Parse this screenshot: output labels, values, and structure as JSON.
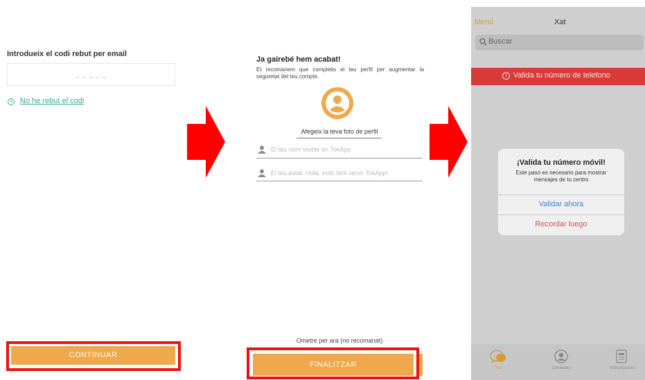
{
  "screen1": {
    "title": "Introdueix el codi rebut per email",
    "code_placeholder": "_ _ _ _ _",
    "no_code_link": "No he rebut el codi",
    "continue_button": "CONTINUAR"
  },
  "screen2": {
    "title": "Ja gairebé hem acabat!",
    "description": "Et recomanem que completis el teu perfil per augmentar la seguretat del teu compte.",
    "add_photo": "Afegeix la teva foto de perfil",
    "name_placeholder": "El teu nom visible en TokApp",
    "status_placeholder": "El teu estat: Hola, estic fent servir TokApp!",
    "skip": "Ometre per ara (no recomanat)",
    "finish_button": "FINALITZAR"
  },
  "screen3": {
    "menu": "Menú",
    "title": "Xat",
    "search_placeholder": "Buscar",
    "banner": "Valida tu número de telefono",
    "dialog": {
      "title": "¡Valida tu número móvil!",
      "body": "Este paso es necesario para mostrar mensajes de tu centro",
      "validate": "Validar ahora",
      "remind": "Recordar luego"
    },
    "tabs": [
      {
        "label": "Xat"
      },
      {
        "label": "Contactes"
      },
      {
        "label": "Subscripcions"
      }
    ]
  },
  "colors": {
    "accent_orange": "#f0a94a",
    "highlight_red": "#ee1111",
    "link_teal": "#3aa88f",
    "banner_red": "#d93a3a",
    "ios_blue": "#3a86d6"
  },
  "icons": [
    "info-icon",
    "arrow-right-icon",
    "avatar-icon",
    "person-icon",
    "search-icon",
    "chat-icon",
    "contacts-icon",
    "subscriptions-icon"
  ]
}
